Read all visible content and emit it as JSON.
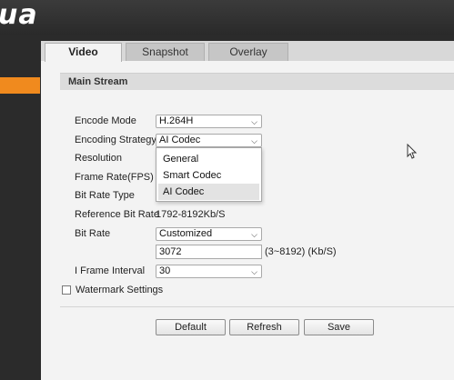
{
  "app": {
    "logo": "ua"
  },
  "tabs": [
    {
      "label": "Video",
      "active": true
    },
    {
      "label": "Snapshot",
      "active": false
    },
    {
      "label": "Overlay",
      "active": false
    }
  ],
  "section": {
    "title": "Main Stream"
  },
  "form": {
    "encode_mode": {
      "label": "Encode Mode",
      "value": "H.264H"
    },
    "encoding_strategy": {
      "label": "Encoding Strategy",
      "value": "AI Codec",
      "options": [
        "General",
        "Smart Codec",
        "AI Codec"
      ],
      "highlighted_option": "AI Codec"
    },
    "resolution": {
      "label": "Resolution"
    },
    "frame_rate": {
      "label": "Frame Rate(FPS)"
    },
    "bit_rate_type": {
      "label": "Bit Rate Type"
    },
    "reference_bit_rate": {
      "label": "Reference Bit Rate",
      "value": "1792-8192Kb/S"
    },
    "bit_rate": {
      "label": "Bit Rate",
      "value": "Customized",
      "custom_value": "3072",
      "hint": "(3~8192) (Kb/S)"
    },
    "i_frame_interval": {
      "label": "I Frame Interval",
      "value": "30"
    },
    "watermark": {
      "label": "Watermark Settings",
      "checked": false
    }
  },
  "buttons": {
    "default": "Default",
    "refresh": "Refresh",
    "save": "Save"
  },
  "colors": {
    "accent": "#f08a1e",
    "topbar": "#2f2f2f",
    "panel": "#f3f3f3"
  }
}
